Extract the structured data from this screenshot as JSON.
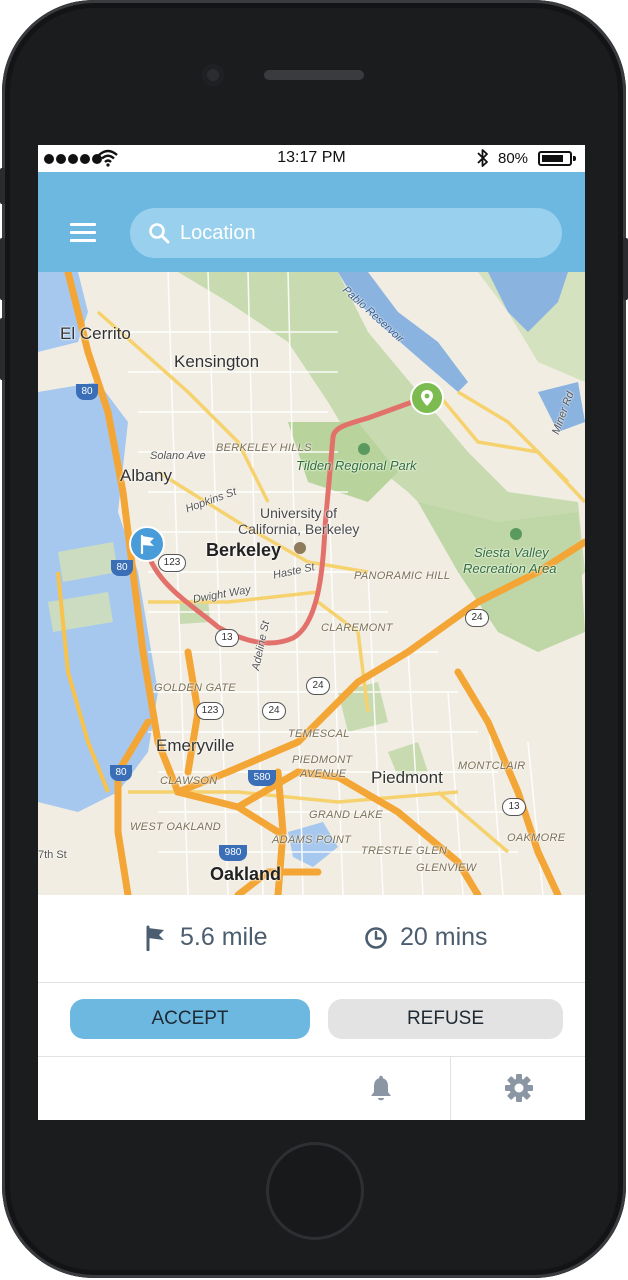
{
  "status_bar": {
    "time": "13:17 PM",
    "battery": "80%",
    "battery_level": 0.8,
    "icons": [
      "signal-dots-icon",
      "wifi-icon",
      "bluetooth-icon",
      "battery-icon"
    ]
  },
  "header": {
    "background_color": "#6db8e1",
    "menu_icon": "hamburger-menu-icon",
    "search": {
      "placeholder": "Location",
      "value": "",
      "icon": "search-icon"
    }
  },
  "map": {
    "route_color": "#e3716b",
    "origin_marker": "flag-pin-icon",
    "destination_marker": "location-pin-icon",
    "labels": {
      "el_cerrito": "El Cerrito",
      "kensington": "Kensington",
      "albany": "Albany",
      "solano_ave": "Solano Ave",
      "berkeley_hills": "BERKELEY HILLS",
      "tilden": "Tilden Regional Park",
      "hopkins": "Hopkins St",
      "university_1": "University of",
      "university_2": "California, Berkeley",
      "berkeley": "Berkeley",
      "dwight": "Dwight Way",
      "haste": "Haste St",
      "adeline": "Adeline St",
      "panoramic": "PANORAMIC HILL",
      "siesta_1": "Siesta Valley",
      "siesta_2": "Recreation Area",
      "claremont": "CLAREMONT",
      "golden_gate": "GOLDEN GATE",
      "emeryville": "Emeryville",
      "temescal": "TEMESCAL",
      "piedmont_ave_1": "PIEDMONT",
      "piedmont_ave_2": "AVENUE",
      "piedmont": "Piedmont",
      "montclair": "MONTCLAIR",
      "clawson": "CLAWSON",
      "west_oakland": "WEST OAKLAND",
      "grand_lake": "GRAND LAKE",
      "adams_point": "ADAMS POINT",
      "trestle_glen": "TRESTLE GLEN",
      "oakmore": "OAKMORE",
      "glenview": "GLENVIEW",
      "oakland": "Oakland",
      "th_st": "7th St",
      "reservoir": "Pablo Reservoir",
      "miner_rd": "Miner Rd"
    },
    "shields": {
      "i80_a": "80",
      "i80_b": "80",
      "i80_c": "80",
      "r123_a": "123",
      "r123_b": "123",
      "r13_a": "13",
      "r13_b": "13",
      "r24_a": "24",
      "r24_b": "24",
      "r24_c": "24",
      "i580": "580",
      "i980": "980"
    }
  },
  "trip": {
    "distance": "5.6 mile",
    "duration": "20 mins",
    "distance_icon": "flag-icon",
    "duration_icon": "clock-icon"
  },
  "actions": {
    "accept": "ACCEPT",
    "refuse": "REFUSE",
    "accept_color": "#6db8e1",
    "refuse_color": "#e3e3e3"
  },
  "tabbar": {
    "icons": [
      "bell-icon",
      "gear-icon"
    ]
  }
}
